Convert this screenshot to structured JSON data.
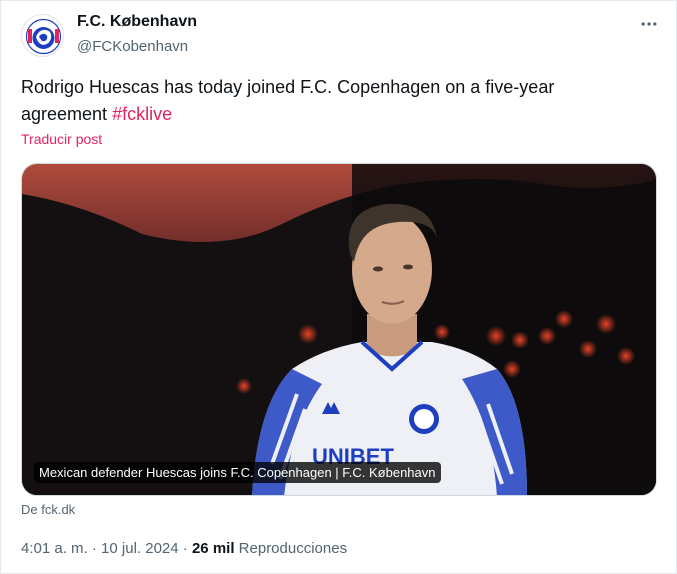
{
  "author": {
    "name": "F.C. København",
    "handle": "@FCKobenhavn",
    "avatar_icon": "fck-lion-crest-icon"
  },
  "tweet": {
    "text": "Rodrigo Huescas has today joined F.C. Copenhagen on a five-year agreement ",
    "hashtag": "#fcklive",
    "translate_label": "Traducir post"
  },
  "media": {
    "caption": "Mexican defender Huescas joins F.C. Copenhagen | F.C. København",
    "source": "De fck.dk",
    "jersey_text": "UNIBET"
  },
  "meta": {
    "time": "4:01 a. m.",
    "separator1": " · ",
    "date": "10 jul. 2024",
    "separator2": " · ",
    "views_count": "26 mil",
    "views_label": "Reproducciones"
  },
  "colors": {
    "accent": "#e0245e",
    "secondary_text": "#536471",
    "club_blue": "#1d3fbf"
  }
}
